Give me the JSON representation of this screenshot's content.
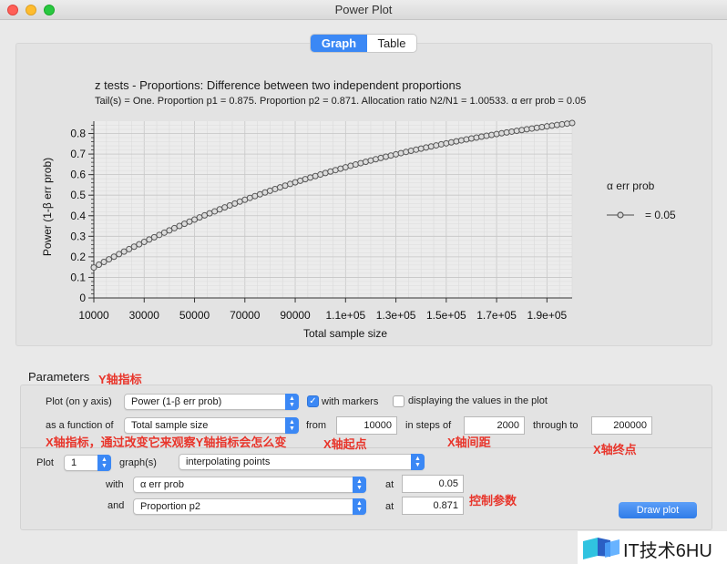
{
  "window": {
    "title": "Power Plot"
  },
  "tabs": [
    {
      "label": "Graph",
      "active": true
    },
    {
      "label": "Table",
      "active": false
    }
  ],
  "chart_data": {
    "type": "line",
    "title": "z tests - Proportions: Difference between two independent proportions",
    "subtitle": "Tail(s) = One. Proportion p1 = 0.875. Proportion p2 = 0.871. Allocation ratio N2/N1 = 1.00533. α err prob = 0.05",
    "xlabel": "Total sample size",
    "ylabel": "Power (1-β err prob)",
    "xlim": [
      10000,
      200000
    ],
    "ylim": [
      0,
      0.86
    ],
    "x_step": 2000,
    "x_ticks": [
      "10000",
      "30000",
      "50000",
      "70000",
      "90000",
      "1.1e+05",
      "1.3e+05",
      "1.5e+05",
      "1.7e+05",
      "1.9e+05"
    ],
    "y_ticks": [
      "0",
      "0.1",
      "0.2",
      "0.3",
      "0.4",
      "0.5",
      "0.6",
      "0.7",
      "0.8"
    ],
    "markers": true,
    "grid": true,
    "legend": {
      "title": "α err prob",
      "placement": "right"
    },
    "series": [
      {
        "name": "= 0.05",
        "color": "#5a5a5a"
      }
    ]
  },
  "params": {
    "section_label": "Parameters",
    "plot_on_y_label": "Plot (on y axis)",
    "y_axis_value": "Power (1-β err prob)",
    "with_markers_label": "with markers",
    "with_markers_checked": true,
    "display_values_label": "displaying the values in the plot",
    "display_values_checked": false,
    "function_of_label": "as a function of",
    "function_of_value": "Total sample size",
    "from_label": "from",
    "from_value": "10000",
    "steps_label": "in steps of",
    "steps_value": "2000",
    "through_label": "through to",
    "through_value": "200000",
    "plot_label": "Plot",
    "plot_count": "1",
    "graphs_label": "graph(s)",
    "graphs_mode": "interpolating points",
    "with_label": "with",
    "with_value": "α err prob",
    "at1_label": "at",
    "at1_value": "0.05",
    "and_label": "and",
    "and_value": "Proportion p2",
    "at2_label": "at",
    "at2_value": "0.871",
    "draw_button": "Draw plot"
  },
  "annotations": {
    "y_metric": "Y轴指标",
    "x_metric": "X轴指标，通过改变它来观察Y轴指标会怎么变",
    "x_start": "X轴起点",
    "x_step": "X轴间距",
    "x_end": "X轴终点",
    "control": "控制参数"
  },
  "watermark": {
    "text": "IT技术6HU"
  }
}
